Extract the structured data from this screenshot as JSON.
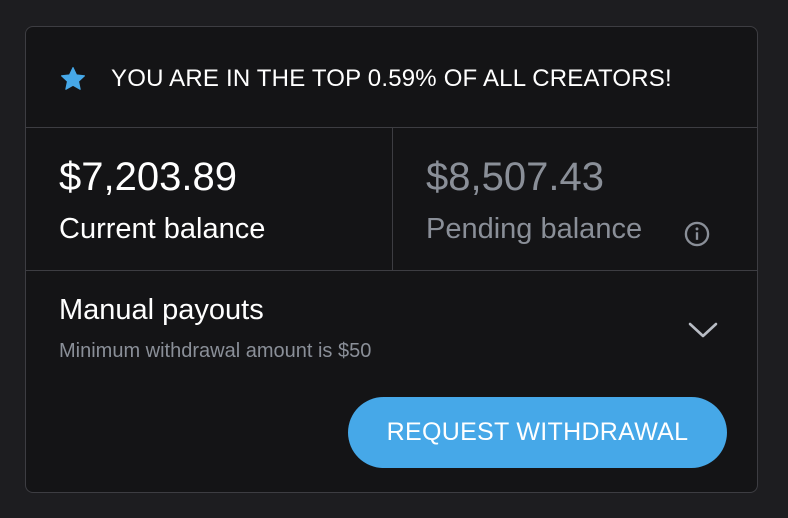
{
  "banner": {
    "icon": "star-icon",
    "text": "YOU ARE IN THE TOP 0.59% OF ALL CREATORS!",
    "icon_color": "#46a8e8"
  },
  "balances": {
    "current": {
      "amount": "$7,203.89",
      "label": "Current balance"
    },
    "pending": {
      "amount": "$8,507.43",
      "label": "Pending balance",
      "icon": "info-icon"
    }
  },
  "payouts": {
    "title": "Manual payouts",
    "subtitle": "Minimum withdrawal amount is $50",
    "expand_icon": "chevron-down-icon"
  },
  "actions": {
    "withdraw_label": "REQUEST WITHDRAWAL",
    "accent_color": "#46a8e8"
  },
  "colors": {
    "background": "#1d1d20",
    "card": "#141416",
    "border": "#3d3d42",
    "muted_text": "#8a8f98"
  }
}
